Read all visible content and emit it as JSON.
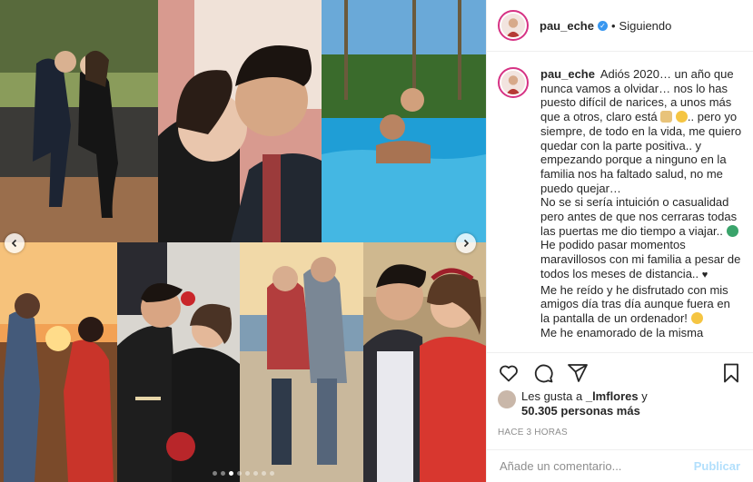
{
  "header": {
    "username": "pau_eche",
    "separator": "•",
    "follow_state": "Siguiendo",
    "verified_glyph": "✓"
  },
  "caption": {
    "username": "pau_eche",
    "line1": "Adiós 2020… un año que nunca vamos a olvidar… nos lo has puesto difícil de narices, a unos más que a otros, claro está",
    "line1b": ".. pero yo siempre, de todo en la vida, me quiero quedar con la parte positiva.. y empezando porque a ninguno en la familia nos ha faltado salud, no me puedo quejar…",
    "line2": "No se si sería intuición o casualidad pero antes de que nos cerraras todas las puertas me dio tiempo a viajar..",
    "line3": "He podido pasar momentos maravillosos con mi familia a pesar de todos los meses de distancia..",
    "line4": "Me he reído y he disfrutado con mis amigos día tras día aunque fuera en la pantalla de un ordenador!",
    "line5": "Me he enamorado de la misma"
  },
  "likes": {
    "prefix": "Les gusta a",
    "user": "_lmflores",
    "connector": "y",
    "count": "50.305 personas más"
  },
  "time_ago": "HACE 3 HORAS",
  "comment_box": {
    "placeholder": "Añade un comentario...",
    "post_label": "Publicar"
  },
  "carousel": {
    "total": 8,
    "active": 2
  },
  "icons": {
    "like": "heart-icon",
    "comment": "comment-icon",
    "share": "share-icon",
    "save": "bookmark-icon",
    "prev": "chevron-left-icon",
    "next": "chevron-right-icon"
  },
  "colors": {
    "verified": "#3897f0",
    "story_ring": "#d63384",
    "post_button": "#b2dffc",
    "muted": "#8e8e8e"
  }
}
